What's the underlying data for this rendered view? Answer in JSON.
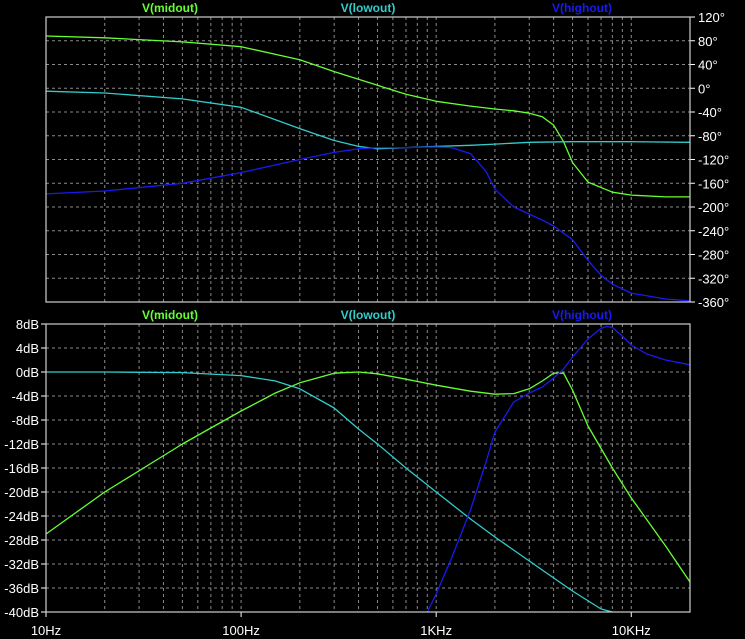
{
  "chart_data": [
    {
      "type": "line",
      "name": "phase",
      "x_scale": "log",
      "xlim": [
        10,
        20000
      ],
      "ylim": [
        -360,
        120
      ],
      "y_ticks": [
        120,
        80,
        40,
        0,
        -40,
        -80,
        -120,
        -160,
        -200,
        -240,
        -280,
        -320,
        -360
      ],
      "y_tick_labels": [
        "120°",
        "80°",
        "40°",
        "0°",
        "-40°",
        "-80°",
        "-120°",
        "-160°",
        "-200°",
        "-240°",
        "-280°",
        "-320°",
        "-360°"
      ],
      "grid": true,
      "legend": "top",
      "series": [
        {
          "name": "V(midout)",
          "color": "#66ff33",
          "x": [
            10,
            20,
            50,
            100,
            200,
            300,
            400,
            500,
            700,
            1000,
            1500,
            2000,
            2500,
            3000,
            3500,
            4000,
            4500,
            5000,
            6000,
            8000,
            10000,
            15000,
            20000
          ],
          "y": [
            88,
            85,
            78,
            70,
            48,
            28,
            15,
            5,
            -10,
            -22,
            -30,
            -35,
            -38,
            -42,
            -48,
            -62,
            -90,
            -125,
            -158,
            -175,
            -180,
            -183,
            -183
          ]
        },
        {
          "name": "V(lowout)",
          "color": "#33cccc",
          "x": [
            10,
            20,
            50,
            100,
            200,
            300,
            400,
            500,
            700,
            1000,
            1500,
            2000,
            3000,
            5000,
            10000,
            20000
          ],
          "y": [
            -5,
            -8,
            -18,
            -32,
            -68,
            -88,
            -98,
            -102,
            -100,
            -98,
            -96,
            -94,
            -91,
            -90,
            -90,
            -91
          ]
        },
        {
          "name": "V(highout)",
          "color": "#1a1aee",
          "x": [
            10,
            20,
            50,
            100,
            200,
            300,
            400,
            500,
            700,
            1000,
            1200,
            1500,
            1800,
            2000,
            2500,
            3000,
            3500,
            4000,
            5000,
            6000,
            7000,
            8000,
            10000,
            15000,
            20000
          ],
          "y": [
            -178,
            -173,
            -160,
            -142,
            -120,
            -108,
            -102,
            -100,
            -100,
            -99,
            -100,
            -110,
            -140,
            -170,
            -200,
            -212,
            -222,
            -232,
            -255,
            -290,
            -315,
            -330,
            -345,
            -355,
            -358
          ]
        }
      ]
    },
    {
      "type": "line",
      "name": "magnitude",
      "x_scale": "log",
      "xlim": [
        10,
        20000
      ],
      "ylim": [
        -40,
        8
      ],
      "y_ticks": [
        8,
        4,
        0,
        -4,
        -8,
        -12,
        -16,
        -20,
        -24,
        -28,
        -32,
        -36,
        -40
      ],
      "y_tick_labels": [
        "8dB",
        "4dB",
        "0dB",
        "-4dB",
        "-8dB",
        "-12dB",
        "-16dB",
        "-20dB",
        "-24dB",
        "-28dB",
        "-32dB",
        "-36dB",
        "-40dB"
      ],
      "x_ticks": [
        10,
        100,
        1000,
        10000
      ],
      "x_tick_labels": [
        "10Hz",
        "100Hz",
        "1KHz",
        "10KHz"
      ],
      "grid": true,
      "legend": "top",
      "series": [
        {
          "name": "V(midout)",
          "color": "#66ff33",
          "x": [
            10,
            20,
            50,
            100,
            150,
            200,
            300,
            400,
            500,
            700,
            1000,
            1500,
            2000,
            2500,
            3000,
            3500,
            4000,
            4500,
            5000,
            6000,
            8000,
            10000,
            15000,
            20000
          ],
          "y": [
            -27,
            -20,
            -12,
            -6.5,
            -3.5,
            -1.8,
            -0.2,
            0,
            -0.3,
            -1.2,
            -2.2,
            -3.2,
            -3.7,
            -3.6,
            -2.8,
            -1.5,
            -0.2,
            -0.2,
            -3,
            -9,
            -16,
            -21,
            -29,
            -35
          ]
        },
        {
          "name": "V(lowout)",
          "color": "#33cccc",
          "x": [
            10,
            20,
            50,
            100,
            150,
            200,
            300,
            400,
            500,
            700,
            1000,
            1500,
            2000,
            3000,
            5000,
            7000,
            8000
          ],
          "y": [
            0,
            0,
            -0.1,
            -0.6,
            -1.5,
            -2.8,
            -6,
            -9.5,
            -12,
            -16,
            -20,
            -24.5,
            -27.5,
            -31.5,
            -36.5,
            -39.5,
            -40
          ]
        },
        {
          "name": "V(highout)",
          "color": "#1a1aee",
          "x": [
            900,
            1000,
            1200,
            1500,
            1800,
            2000,
            2500,
            3000,
            3500,
            4000,
            4500,
            5000,
            6000,
            7000,
            7500,
            8000,
            9000,
            10000,
            12000,
            15000,
            20000
          ],
          "y": [
            -40,
            -37,
            -31,
            -23,
            -15,
            -10,
            -5,
            -3.5,
            -2.5,
            -1,
            0.5,
            2.5,
            5.5,
            7.3,
            7.6,
            7.4,
            6,
            4.5,
            3,
            2,
            1.2
          ]
        }
      ]
    }
  ]
}
